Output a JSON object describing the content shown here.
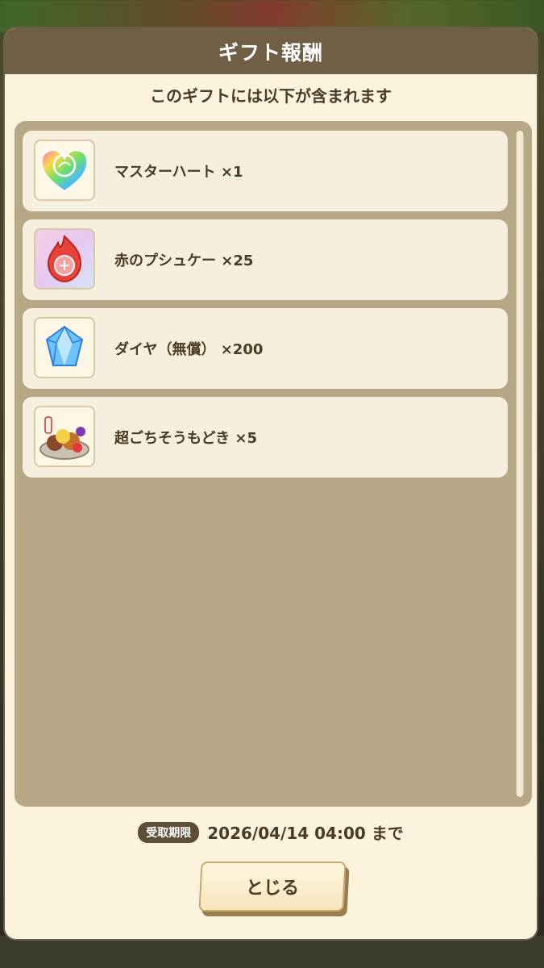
{
  "dialog": {
    "title": "ギフト報酬",
    "subtitle": "このギフトには以下が含まれます"
  },
  "rewards": [
    {
      "label": "マスターハート ×1",
      "icon": "master-heart-icon"
    },
    {
      "label": "赤のプシュケー ×25",
      "icon": "red-psyche-icon"
    },
    {
      "label": "ダイヤ（無償） ×200",
      "icon": "diamond-icon"
    },
    {
      "label": "超ごちそうもどき ×5",
      "icon": "feast-icon"
    }
  ],
  "expiry": {
    "badge": "受取期限",
    "text": "2026/04/14 04:00 まで"
  },
  "close_button": {
    "label": "とじる"
  },
  "colors": {
    "header": "#6e5f45",
    "panel": "#fbf3dc",
    "list_bg": "#b6a887",
    "item_bg": "#f6efdd",
    "text": "#4a3b26"
  }
}
